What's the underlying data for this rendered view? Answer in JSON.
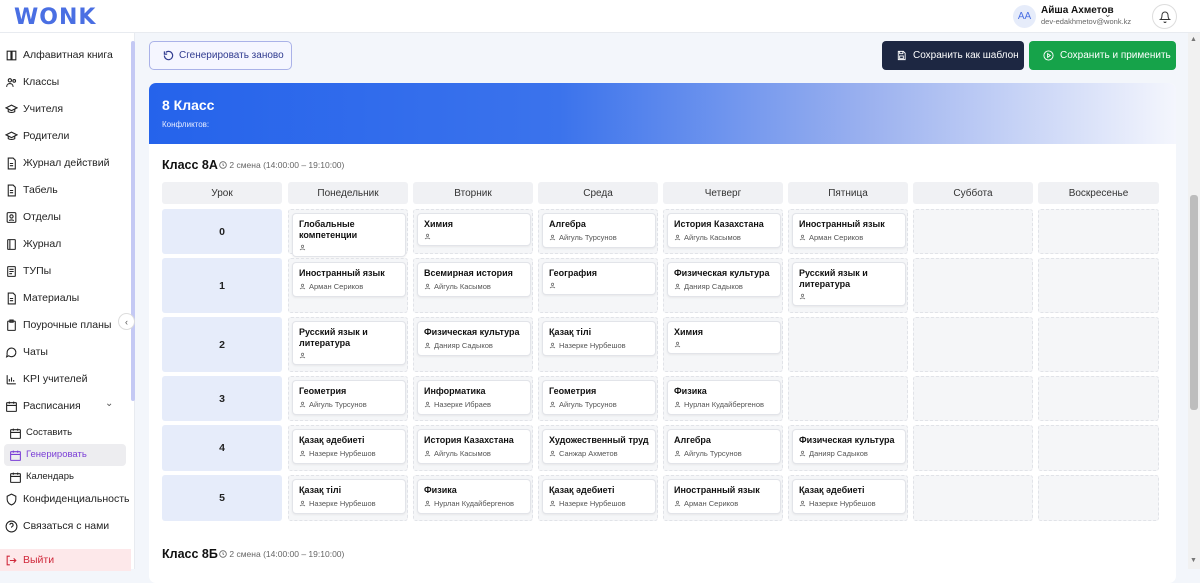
{
  "header": {
    "logo": "WONK",
    "avatar_initials": "AA",
    "user_name": "Айша Ахметов",
    "user_email": "dev-edakhmetov@wonk.kz"
  },
  "sidebar": {
    "items": [
      {
        "label": "Алфавитная книга",
        "icon": "book-icon"
      },
      {
        "label": "Классы",
        "icon": "users-icon"
      },
      {
        "label": "Учителя",
        "icon": "graduation-cap-icon"
      },
      {
        "label": "Родители",
        "icon": "graduation-cap-icon"
      },
      {
        "label": "Журнал действий",
        "icon": "file-icon"
      },
      {
        "label": "Табель",
        "icon": "file-icon"
      },
      {
        "label": "Отделы",
        "icon": "id-card-icon"
      },
      {
        "label": "Журнал",
        "icon": "journal-icon"
      },
      {
        "label": "ТУПы",
        "icon": "document-icon"
      },
      {
        "label": "Материалы",
        "icon": "file-icon"
      },
      {
        "label": "Поурочные планы",
        "icon": "clipboard-icon"
      },
      {
        "label": "Чаты",
        "icon": "chat-icon"
      },
      {
        "label": "KPI учителей",
        "icon": "chart-icon"
      },
      {
        "label": "Расписания",
        "icon": "calendar-icon"
      }
    ],
    "sub_items": [
      {
        "label": "Составить",
        "icon": "calendar-icon"
      },
      {
        "label": "Генерировать",
        "icon": "calendar-icon"
      },
      {
        "label": "Календарь",
        "icon": "calendar-icon"
      }
    ],
    "bottom_items": [
      {
        "label": "Конфиденциальность",
        "icon": "shield-icon"
      },
      {
        "label": "Связаться с нами",
        "icon": "help-icon"
      },
      {
        "label": "Выйти",
        "icon": "logout-icon"
      }
    ]
  },
  "toolbar": {
    "regen": "Сгенерировать заново",
    "save_template": "Сохранить как шаблон",
    "save_apply": "Сохранить и применить"
  },
  "banner": {
    "title": "8 Класс",
    "subtitle": "Конфликтов:"
  },
  "classes": [
    {
      "name": "Класс 8А",
      "shift": "2 смена (14:00:00 – 19:10:00)"
    },
    {
      "name": "Класс 8Б",
      "shift": "2 смена (14:00:00 – 19:10:00)"
    }
  ],
  "table": {
    "headers": [
      "Урок",
      "Понедельник",
      "Вторник",
      "Среда",
      "Четверг",
      "Пятница",
      "Суббота",
      "Воскресенье"
    ],
    "rows": [
      {
        "num": "0",
        "cells": [
          {
            "subject": "Глобальные компетенции",
            "teacher": ""
          },
          {
            "subject": "Химия",
            "teacher": ""
          },
          {
            "subject": "Алгебра",
            "teacher": "Айгуль Турсунов"
          },
          {
            "subject": "История Казахстана",
            "teacher": "Айгуль Касымов"
          },
          {
            "subject": "Иностранный язык",
            "teacher": "Арман Сериков"
          },
          null,
          null
        ]
      },
      {
        "num": "1",
        "cells": [
          {
            "subject": "Иностранный язык",
            "teacher": "Арман Сериков"
          },
          {
            "subject": "Всемирная история",
            "teacher": "Айгуль Касымов"
          },
          {
            "subject": "География",
            "teacher": ""
          },
          {
            "subject": "Физическая культура",
            "teacher": "Данияр Садыков"
          },
          {
            "subject": "Русский язык и литература",
            "teacher": ""
          },
          null,
          null
        ]
      },
      {
        "num": "2",
        "cells": [
          {
            "subject": "Русский язык и литература",
            "teacher": ""
          },
          {
            "subject": "Физическая культура",
            "teacher": "Данияр Садыков"
          },
          {
            "subject": "Қазақ тілі",
            "teacher": "Назерке Нурбешов"
          },
          {
            "subject": "Химия",
            "teacher": ""
          },
          null,
          null,
          null
        ]
      },
      {
        "num": "3",
        "cells": [
          {
            "subject": "Геометрия",
            "teacher": "Айгуль Турсунов"
          },
          {
            "subject": "Информатика",
            "teacher": "Назерке Ибраев"
          },
          {
            "subject": "Геометрия",
            "teacher": "Айгуль Турсунов"
          },
          {
            "subject": "Физика",
            "teacher": "Нурлан Кудайбергенов"
          },
          null,
          null,
          null
        ]
      },
      {
        "num": "4",
        "cells": [
          {
            "subject": "Қазақ әдебиеті",
            "teacher": "Назерке Нурбешов"
          },
          {
            "subject": "История Казахстана",
            "teacher": "Айгуль Касымов"
          },
          {
            "subject": "Художественный труд",
            "teacher": "Санжар Ахметов"
          },
          {
            "subject": "Алгебра",
            "teacher": "Айгуль Турсунов"
          },
          {
            "subject": "Физическая культура",
            "teacher": "Данияр Садыков"
          },
          null,
          null
        ]
      },
      {
        "num": "5",
        "cells": [
          {
            "subject": "Қазақ тілі",
            "teacher": "Назерке Нурбешов"
          },
          {
            "subject": "Физика",
            "teacher": "Нурлан Кудайбергенов"
          },
          {
            "subject": "Қазақ әдебиеті",
            "teacher": "Назерке Нурбешов"
          },
          {
            "subject": "Иностранный язык",
            "teacher": "Арман Сериков"
          },
          {
            "subject": "Қазақ әдебиеті",
            "teacher": "Назерке Нурбешов"
          },
          null,
          null
        ]
      }
    ]
  }
}
